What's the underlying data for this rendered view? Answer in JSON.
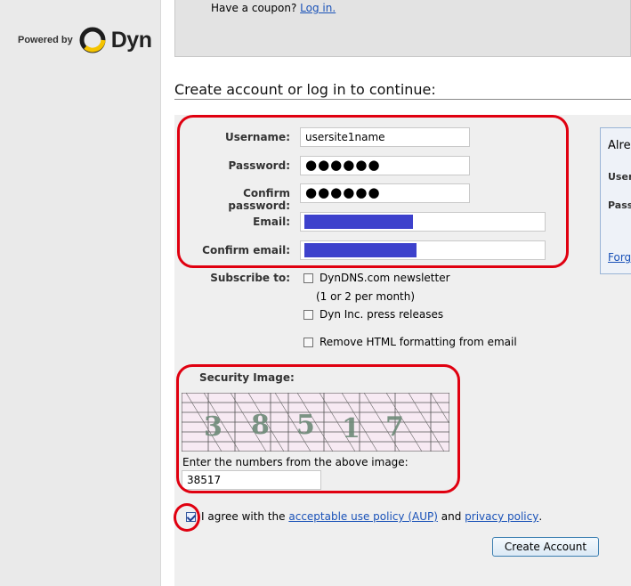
{
  "sidebar": {
    "powered_by": "Powered by",
    "brand": "Dyn"
  },
  "coupon": {
    "text": "Have a coupon?",
    "link": "Log in."
  },
  "section_title": "Create account or log in to continue:",
  "form": {
    "username_label": "Username:",
    "username_value": "usersite1name",
    "password_label": "Password:",
    "password_value": "●●●●●●",
    "confirm_password_label": "Confirm password:",
    "confirm_password_value": "●●●●●●",
    "email_label": "Email:",
    "confirm_email_label": "Confirm email:",
    "redaction_color": "#3d41cc"
  },
  "subscribe": {
    "label": "Subscribe to:",
    "options": [
      {
        "label": "DynDNS.com newsletter",
        "checked": false
      },
      {
        "label": "Dyn Inc. press releases",
        "checked": false
      },
      {
        "label": "Remove HTML formatting from email",
        "checked": false
      }
    ],
    "newsletter_note": "(1 or 2 per month)"
  },
  "security": {
    "title": "Security Image:",
    "captcha_digits": "38517",
    "instruction": "Enter the numbers from the above image:",
    "input_value": "38517"
  },
  "agreement": {
    "checked": true,
    "prefix": "I agree with the",
    "aup_link": "acceptable use policy (AUP)",
    "and": "and",
    "privacy_link": "privacy policy",
    "suffix": "."
  },
  "create_button": "Create Account",
  "login_panel": {
    "heading": "Alre",
    "user": "User",
    "pass": "Pass",
    "forgot": "Forg"
  },
  "colors": {
    "highlight": "#e00010",
    "link": "#1a52b8",
    "sidebar": "#eaeaea",
    "panel": "#efefef"
  }
}
